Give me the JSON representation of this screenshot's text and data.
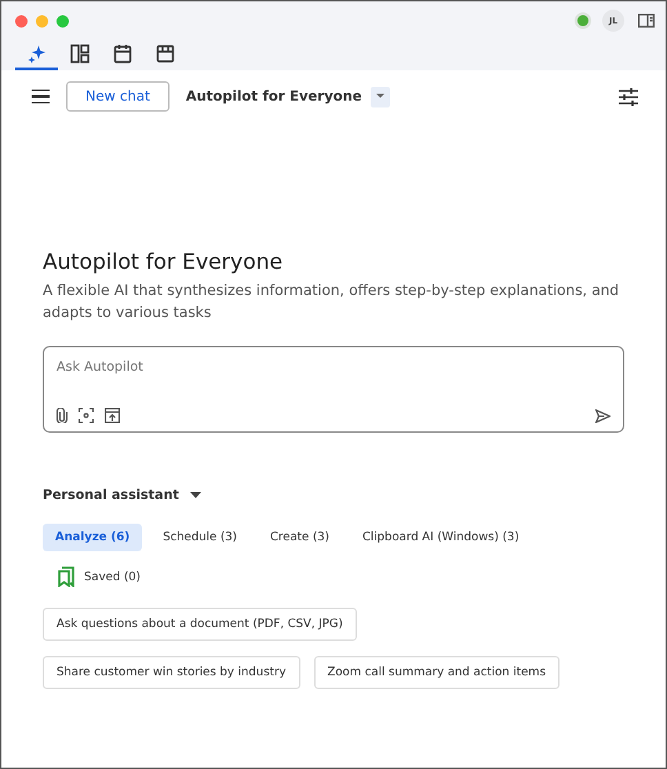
{
  "window": {
    "status_online": true,
    "avatar": "JL"
  },
  "app_tabs": [
    {
      "kind": "sparkle",
      "selected": true
    },
    {
      "kind": "layout",
      "selected": false
    },
    {
      "kind": "calendar",
      "selected": false
    },
    {
      "kind": "store",
      "selected": false
    }
  ],
  "toolbar": {
    "new_chat": "New chat",
    "assistant": "Autopilot for Everyone"
  },
  "intro": {
    "title": "Autopilot for Everyone",
    "description": "A flexible AI that synthesizes information, offers step-by-step explanations, and adapts to various tasks"
  },
  "prompt": {
    "placeholder": "Ask Autopilot"
  },
  "section": {
    "label": "Personal assistant"
  },
  "categories": [
    {
      "label": "Analyze (6)",
      "selected": true,
      "kind": "plain"
    },
    {
      "label": "Schedule (3)",
      "selected": false,
      "kind": "plain"
    },
    {
      "label": "Create (3)",
      "selected": false,
      "kind": "plain"
    },
    {
      "label": "Clipboard AI (Windows) (3)",
      "selected": false,
      "kind": "plain"
    },
    {
      "label": "Saved (0)",
      "selected": false,
      "kind": "saved"
    }
  ],
  "suggestions": [
    "Ask questions about a document (PDF, CSV, JPG)",
    "Share customer win stories by industry",
    "Zoom call summary and action items"
  ]
}
